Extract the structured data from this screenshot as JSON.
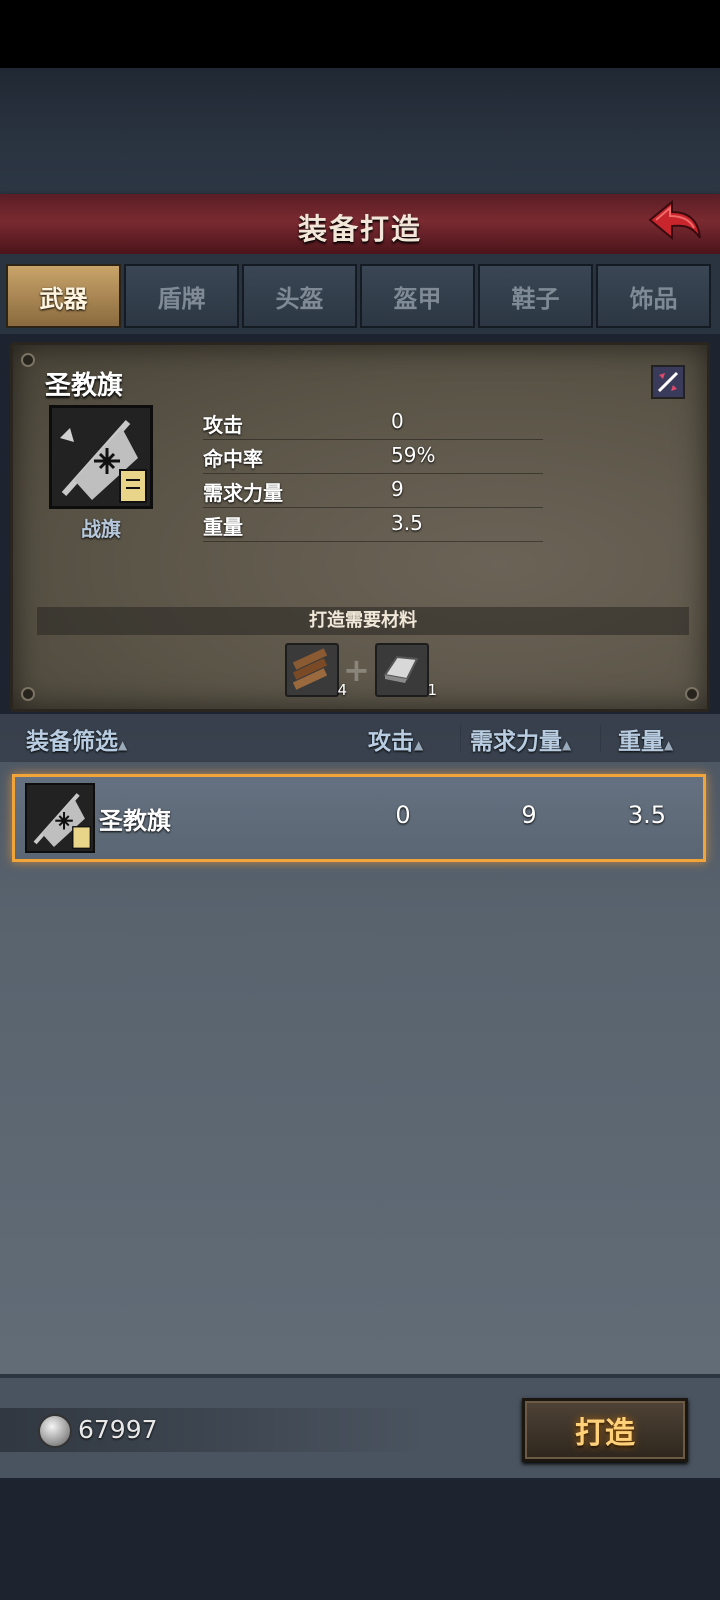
{
  "header": {
    "title": "装备打造"
  },
  "tabs": [
    {
      "label": "武器",
      "active": true
    },
    {
      "label": "盾牌",
      "active": false
    },
    {
      "label": "头盔",
      "active": false
    },
    {
      "label": "盔甲",
      "active": false
    },
    {
      "label": "鞋子",
      "active": false
    },
    {
      "label": "饰品",
      "active": false
    }
  ],
  "detail": {
    "name": "圣教旗",
    "type": "战旗",
    "stats": [
      {
        "label": "攻击",
        "value": "0"
      },
      {
        "label": "命中率",
        "value": "59%"
      },
      {
        "label": "需求力量",
        "value": "9"
      },
      {
        "label": "重量",
        "value": "3.5"
      }
    ],
    "materials_title": "打造需要材料",
    "materials": [
      {
        "icon": "wood-planks-icon",
        "count": "4"
      },
      {
        "icon": "iron-ingot-icon",
        "count": "1"
      }
    ]
  },
  "list": {
    "headers": {
      "filter": "装备筛选",
      "attack": "攻击",
      "strength": "需求力量",
      "weight": "重量"
    },
    "rows": [
      {
        "name": "圣教旗",
        "attack": "0",
        "strength": "9",
        "weight": "3.5",
        "selected": true
      }
    ]
  },
  "footer": {
    "currency": "67997",
    "forge_label": "打造"
  },
  "colors": {
    "accent": "#f0a43a",
    "title_bar": "#7a2a31",
    "active_tab": "#c9a46a"
  }
}
